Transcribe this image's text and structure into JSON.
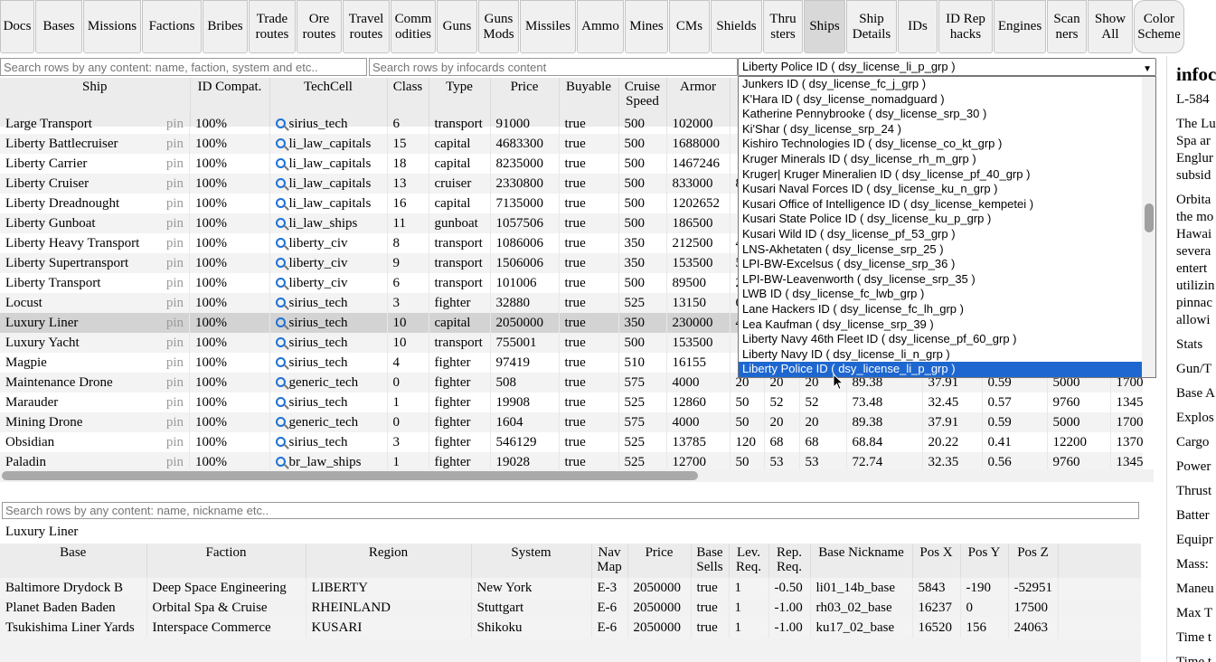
{
  "nav": {
    "items": [
      {
        "label": "Docs",
        "w": 38
      },
      {
        "label": "Bases",
        "w": 52
      },
      {
        "label": "Missions",
        "w": 64
      },
      {
        "label": "Factions",
        "w": 66
      },
      {
        "label": "Bribes",
        "w": 50
      },
      {
        "label": "Trade\nroutes",
        "w": 52
      },
      {
        "label": "Ore\nroutes",
        "w": 50
      },
      {
        "label": "Travel\nroutes",
        "w": 52
      },
      {
        "label": "Comm\nodities",
        "w": 50
      },
      {
        "label": "Guns",
        "w": 45
      },
      {
        "label": "Guns\nMods",
        "w": 45
      },
      {
        "label": "Missiles",
        "w": 62
      },
      {
        "label": "Ammo",
        "w": 52
      },
      {
        "label": "Mines",
        "w": 48
      },
      {
        "label": "CMs",
        "w": 45
      },
      {
        "label": "Shields",
        "w": 57
      },
      {
        "label": "Thru\nsters",
        "w": 44
      },
      {
        "label": "Ships",
        "w": 46,
        "active": true
      },
      {
        "label": "Ship\nDetails",
        "w": 56
      },
      {
        "label": "IDs",
        "w": 44
      },
      {
        "label": "ID Rep\nhacks",
        "w": 60
      },
      {
        "label": "Engines",
        "w": 58
      },
      {
        "label": "Scan\nners",
        "w": 44
      },
      {
        "label": "Show\nAll",
        "w": 50
      },
      {
        "label": "Color\nScheme",
        "w": 56,
        "round": true
      }
    ]
  },
  "search": {
    "rows_placeholder": "Search rows by any content: name, faction, system and etc..",
    "infocards_placeholder": "Search rows by infocards content",
    "bottom_placeholder": "Search rows by any content: name, nickname etc.."
  },
  "id_select": {
    "value": "Liberty Police ID ( dsy_license_li_p_grp )",
    "options": [
      "Junkers ID ( dsy_license_fc_j_grp )",
      "K'Hara ID ( dsy_license_nomadguard )",
      "Katherine Pennybrooke ( dsy_license_srp_30 )",
      "Ki'Shar ( dsy_license_srp_24 )",
      "Kishiro Technologies ID ( dsy_license_co_kt_grp )",
      "Kruger Minerals ID ( dsy_license_rh_m_grp )",
      "Kruger| Kruger Mineralien ID ( dsy_license_pf_40_grp )",
      "Kusari Naval Forces ID ( dsy_license_ku_n_grp )",
      "Kusari Office of Intelligence ID ( dsy_license_kempetei )",
      "Kusari State Police ID ( dsy_license_ku_p_grp )",
      "Kusari Wild ID ( dsy_license_pf_53_grp )",
      "LNS-Akhetaten ( dsy_license_srp_25 )",
      "LPI-BW-Excelsus ( dsy_license_srp_36 )",
      "LPI-BW-Leavenworth ( dsy_license_srp_35 )",
      "LWB ID ( dsy_license_fc_lwb_grp )",
      "Lane Hackers ID ( dsy_license_fc_lh_grp )",
      "Lea Kaufman ( dsy_license_srp_39 )",
      "Liberty Navy 46th Fleet ID ( dsy_license_pf_60_grp )",
      "Liberty Navy ID ( dsy_license_li_n_grp )",
      "Liberty Police ID ( dsy_license_li_p_grp )"
    ]
  },
  "ships": {
    "columns": [
      {
        "label": "Ship",
        "w": 210
      },
      {
        "label": "ID Compat.",
        "w": 88
      },
      {
        "label": "TechCell",
        "w": 130
      },
      {
        "label": "Class",
        "w": 46
      },
      {
        "label": "Type",
        "w": 68
      },
      {
        "label": "Price",
        "w": 76
      },
      {
        "label": "Buyable",
        "w": 66
      },
      {
        "label": "Cruise Speed",
        "w": 53
      },
      {
        "label": "Armor",
        "w": 70
      },
      {
        "label": "",
        "w": 38
      },
      {
        "label": "",
        "w": 39
      },
      {
        "label": "",
        "w": 52
      },
      {
        "label": "",
        "w": 84
      },
      {
        "label": "",
        "w": 66
      },
      {
        "label": "",
        "w": 72
      },
      {
        "label": "",
        "w": 70
      },
      {
        "label": "",
        "w": 40
      }
    ],
    "pin_label": "pin",
    "rows": [
      [
        "Large Transport",
        "100%",
        "sirius_tech",
        "6",
        "transport",
        "91000",
        "true",
        "500",
        "102000",
        "",
        "",
        "",
        "",
        "",
        "",
        "",
        ""
      ],
      [
        "Liberty Battlecruiser",
        "100%",
        "li_law_capitals",
        "15",
        "capital",
        "4683300",
        "true",
        "500",
        "1688000",
        "",
        "",
        "",
        "",
        "",
        "",
        "",
        ""
      ],
      [
        "Liberty Carrier",
        "100%",
        "li_law_capitals",
        "18",
        "capital",
        "8235000",
        "true",
        "500",
        "1467246",
        "",
        "",
        "",
        "",
        "",
        "",
        "",
        ""
      ],
      [
        "Liberty Cruiser",
        "100%",
        "li_law_capitals",
        "13",
        "cruiser",
        "2330800",
        "true",
        "500",
        "833000",
        "8",
        "",
        "",
        "",
        "",
        "",
        "",
        ""
      ],
      [
        "Liberty Dreadnought",
        "100%",
        "li_law_capitals",
        "16",
        "capital",
        "7135000",
        "true",
        "500",
        "1202652",
        "",
        "",
        "",
        "",
        "",
        "",
        "",
        ""
      ],
      [
        "Liberty Gunboat",
        "100%",
        "li_law_ships",
        "11",
        "gunboat",
        "1057506",
        "true",
        "500",
        "186500",
        "",
        "",
        "",
        "",
        "",
        "",
        "",
        ""
      ],
      [
        "Liberty Heavy Transport",
        "100%",
        "liberty_civ",
        "8",
        "transport",
        "1086006",
        "true",
        "350",
        "212500",
        "4",
        "",
        "",
        "",
        "",
        "",
        "",
        ""
      ],
      [
        "Liberty Supertransport",
        "100%",
        "liberty_civ",
        "9",
        "transport",
        "1506006",
        "true",
        "350",
        "153500",
        "5",
        "",
        "",
        "",
        "",
        "",
        "",
        ""
      ],
      [
        "Liberty Transport",
        "100%",
        "liberty_civ",
        "6",
        "transport",
        "101006",
        "true",
        "500",
        "89500",
        "2",
        "",
        "",
        "",
        "",
        "",
        "",
        ""
      ],
      [
        "Locust",
        "100%",
        "sirius_tech",
        "3",
        "fighter",
        "32880",
        "true",
        "525",
        "13150",
        "6",
        "",
        "",
        "",
        "",
        "",
        "",
        ""
      ],
      [
        "Luxury Liner",
        "100%",
        "sirius_tech",
        "10",
        "capital",
        "2050000",
        "true",
        "350",
        "230000",
        "4",
        "",
        "",
        "",
        "",
        "",
        "",
        ""
      ],
      [
        "Luxury Yacht",
        "100%",
        "sirius_tech",
        "10",
        "transport",
        "755001",
        "true",
        "500",
        "153500",
        "",
        "",
        "",
        "",
        "",
        "",
        "",
        ""
      ],
      [
        "Magpie",
        "100%",
        "sirius_tech",
        "4",
        "fighter",
        "97419",
        "true",
        "510",
        "16155",
        "",
        "",
        "",
        "",
        "",
        "",
        "",
        ""
      ],
      [
        "Maintenance Drone",
        "100%",
        "generic_tech",
        "0",
        "fighter",
        "508",
        "true",
        "575",
        "4000",
        "20",
        "20",
        "20",
        "89.38",
        "37.91",
        "0.59",
        "5000",
        "1700"
      ],
      [
        "Marauder",
        "100%",
        "sirius_tech",
        "1",
        "fighter",
        "19908",
        "true",
        "525",
        "12860",
        "50",
        "52",
        "52",
        "73.48",
        "32.45",
        "0.57",
        "9760",
        "1345"
      ],
      [
        "Mining Drone",
        "100%",
        "generic_tech",
        "0",
        "fighter",
        "1604",
        "true",
        "575",
        "4000",
        "50",
        "20",
        "20",
        "89.38",
        "37.91",
        "0.59",
        "5000",
        "1700"
      ],
      [
        "Obsidian",
        "100%",
        "sirius_tech",
        "3",
        "fighter",
        "546129",
        "true",
        "525",
        "13785",
        "120",
        "68",
        "68",
        "68.84",
        "20.22",
        "0.41",
        "12200",
        "1370"
      ],
      [
        "Paladin",
        "100%",
        "br_law_ships",
        "1",
        "fighter",
        "19028",
        "true",
        "525",
        "12700",
        "50",
        "53",
        "53",
        "72.74",
        "32.35",
        "0.56",
        "9760",
        "1345"
      ]
    ],
    "selected_row": 10
  },
  "bases": {
    "selected_ship": "Luxury Liner",
    "columns": [
      {
        "label": "Base",
        "w": 162
      },
      {
        "label": "Faction",
        "w": 176
      },
      {
        "label": "Region",
        "w": 183
      },
      {
        "label": "System",
        "w": 133
      },
      {
        "label": "Nav Map",
        "w": 40
      },
      {
        "label": "Price",
        "w": 70
      },
      {
        "label": "Base Sells",
        "w": 42
      },
      {
        "label": "Lev. Req.",
        "w": 44
      },
      {
        "label": "Rep. Req.",
        "w": 46
      },
      {
        "label": "Base Nickname",
        "w": 113
      },
      {
        "label": "Pos X",
        "w": 53
      },
      {
        "label": "Pos Y",
        "w": 53
      },
      {
        "label": "Pos Z",
        "w": 55
      },
      {
        "label": "",
        "w": 94
      }
    ],
    "rows": [
      [
        "Baltimore Drydock B",
        "Deep Space Engineering",
        "LIBERTY",
        "New York",
        "E-3",
        "2050000",
        "true",
        "1",
        "-0.50",
        "li01_14b_base",
        "5843",
        "-190",
        "-52951",
        ""
      ],
      [
        "Planet Baden Baden",
        "Orbital Spa & Cruise",
        "RHEINLAND",
        "Stuttgart",
        "E-6",
        "2050000",
        "true",
        "1",
        "-1.00",
        "rh03_02_base",
        "16237",
        "0",
        "17500",
        ""
      ],
      [
        "Tsukishima Liner Yards",
        "Interspace Commerce",
        "KUSARI",
        "Shikoku",
        "E-6",
        "2050000",
        "true",
        "1",
        "-1.00",
        "ku17_02_base",
        "16520",
        "156",
        "24063",
        ""
      ]
    ]
  },
  "infocard": {
    "title": "infoc",
    "lines": [
      "L-584",
      "",
      "The Lu",
      "Spa ar",
      "Englur",
      "subsid",
      "",
      "Orbita",
      "the mo",
      "Hawai",
      "severa",
      "entert",
      "utilizin",
      "pinnac",
      "allowi",
      "",
      "Stats",
      "",
      "Gun/T",
      "",
      "Base A",
      "",
      "Explos",
      "",
      "Cargo",
      "",
      "Power",
      "",
      "Thrust",
      "",
      "Batter",
      "",
      "Equipr",
      "",
      "Mass:",
      "",
      "Maneu",
      "",
      "Max T",
      "",
      "Time t",
      "",
      "Time t"
    ]
  }
}
